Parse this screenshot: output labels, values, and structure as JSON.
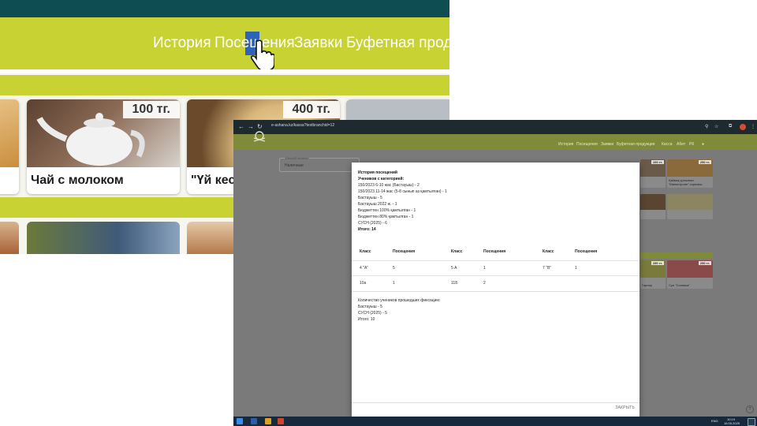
{
  "zoom": {
    "nav": [
      "История",
      "Посещения",
      "Заявки",
      "Буфетная продук"
    ],
    "cards": [
      {
        "price": "100 тг.",
        "name": "Чай с молоком"
      },
      {
        "price": "400 тг.",
        "name": "\"Үй кесп"
      }
    ]
  },
  "browser": {
    "url": "e-ashana.kz/kassa?textbranchid=12",
    "app_nav": [
      "История",
      "Посещения",
      "Заявки",
      "Буфетная продукция",
      "Касса",
      "Абит",
      "РК"
    ],
    "filter": {
      "label": "Способ оплаты",
      "value": "Наличные"
    },
    "cards": [
      {
        "price": "100 тг.",
        "name": ""
      },
      {
        "price": "250 тг.",
        "name": "Қаймақ қосылған \"Минестроне\" сорпасы"
      },
      {
        "price": "250 тг.",
        "name": ""
      },
      {
        "price": "250 тг.",
        "name": "Гарнир"
      },
      {
        "price": "250 тг.",
        "name": "Суп \"Солянка\""
      }
    ],
    "modal": {
      "title": "История посещений",
      "subtitle": "Учеников с категорией:",
      "lines": [
        "150/2023 6-10 жас (Бастауыш) - 2",
        "150/2023 11-14 жас (5-8 сынып аз қамтылған) - 1",
        "Бастауыш - 5",
        "Бастауыш 2022 ж. - 1",
        "Бюджеттен 100% қамтылған - 1",
        "Бюджеттен 80% қамтылған - 1",
        "СУСН (2025) - 6"
      ],
      "total": "Итого: 14",
      "table_headers": [
        "Класс",
        "Посещения",
        "Класс",
        "Посещения",
        "Класс",
        "Посещения"
      ],
      "table_rows": [
        [
          "4 \"А\"",
          "5",
          "5 А",
          "1",
          "7 \"В\"",
          "1"
        ],
        [
          "10а",
          "1",
          "11Б",
          "2",
          "",
          ""
        ]
      ],
      "fix_title": "Количество учеников прошедших фиксацию:",
      "fix_lines": [
        "Бастауыш - 5",
        "СУСН (2025) - 5"
      ],
      "fix_total": "Итого: 10",
      "close_label": "ЗАКРЫТЬ"
    },
    "taskbar": {
      "lang": "ENG",
      "time": "10:19",
      "date": "16.05.2025"
    }
  }
}
